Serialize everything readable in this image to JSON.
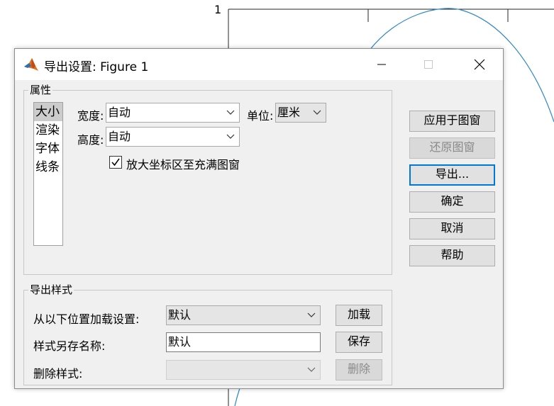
{
  "background": {
    "axis_tick_label": "1",
    "curve_color": "#2f87c4"
  },
  "window": {
    "title": "导出设置: Figure 1",
    "icon": "matlab-icon",
    "minimize_icon": "minimize-icon",
    "maximize_icon": "maximize-icon",
    "close_icon": "close-icon"
  },
  "properties": {
    "label": "属性",
    "categories": [
      {
        "label": "大小",
        "selected": true
      },
      {
        "label": "渲染",
        "selected": false
      },
      {
        "label": "字体",
        "selected": false
      },
      {
        "label": "线条",
        "selected": false
      }
    ],
    "width_label": "宽度:",
    "width_value": "自动",
    "height_label": "高度:",
    "height_value": "自动",
    "units_label": "单位:",
    "units_value": "厘米",
    "expand_checkbox_label": "放大坐标区至充满图窗",
    "expand_checked": true
  },
  "actions": {
    "apply": "应用于图窗",
    "revert": "还原图窗",
    "export": "导出...",
    "ok": "确定",
    "cancel": "取消",
    "help": "帮助"
  },
  "export_styles": {
    "label": "导出样式",
    "load_label": "从以下位置加载设置:",
    "load_value": "默认",
    "load_button": "加载",
    "save_label": "样式另存名称:",
    "save_value": "默认",
    "save_button": "保存",
    "delete_label": "删除样式:",
    "delete_value": "",
    "delete_button": "删除"
  }
}
